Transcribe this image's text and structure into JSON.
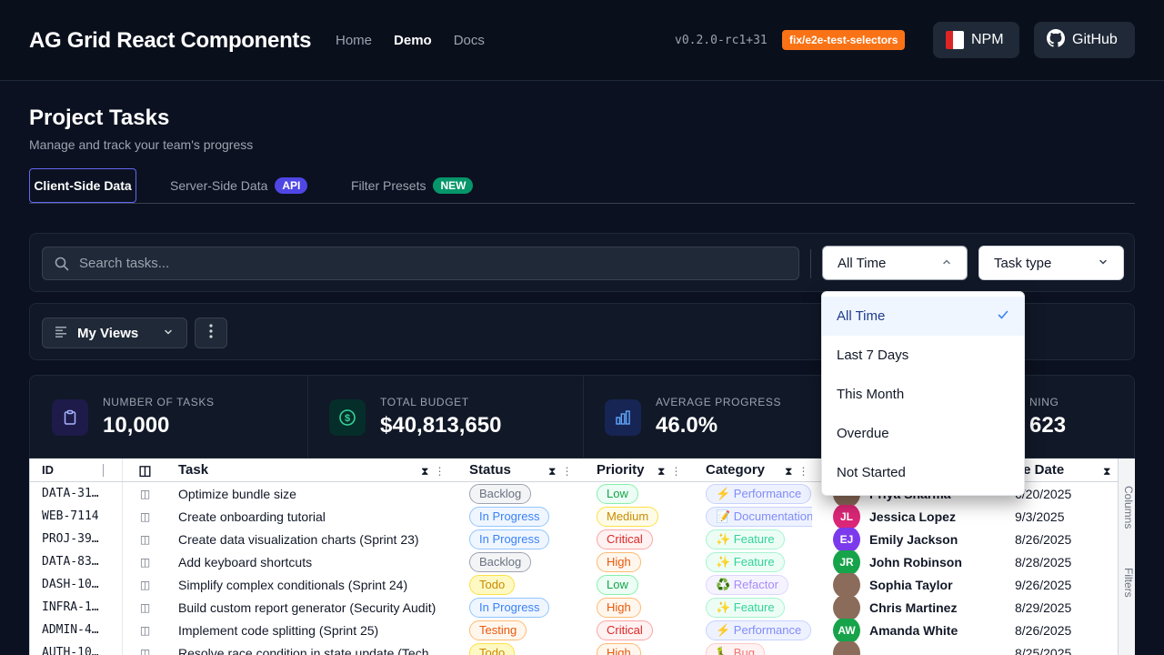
{
  "header": {
    "brand": "AG Grid React Components",
    "nav": [
      "Home",
      "Demo",
      "Docs"
    ],
    "version": "v0.2.0-rc1+31",
    "branch": "fix/e2e-test-selectors",
    "npm_label": "NPM",
    "github_label": "GitHub"
  },
  "page": {
    "title": "Project Tasks",
    "subtitle": "Manage and track your team's progress"
  },
  "tabs": [
    {
      "label": "Client-Side Data",
      "badge": ""
    },
    {
      "label": "Server-Side Data",
      "badge": "API"
    },
    {
      "label": "Filter Presets",
      "badge": "NEW"
    }
  ],
  "filters": {
    "search_placeholder": "Search tasks...",
    "time_value": "All Time",
    "type_value": "Task type"
  },
  "views": {
    "label": "My Views"
  },
  "stats": [
    {
      "label": "NUMBER OF TASKS",
      "value": "10,000"
    },
    {
      "label": "TOTAL BUDGET",
      "value": "$40,813,650"
    },
    {
      "label": "AVERAGE PROGRESS",
      "value": "46.0%"
    },
    {
      "label": "NING",
      "value": "623"
    }
  ],
  "grid": {
    "headers": {
      "id": "ID",
      "task": "Task",
      "status": "Status",
      "priority": "Priority",
      "category": "Category",
      "due": "ue Date"
    },
    "rows": [
      {
        "id": "DATA-31…",
        "task": "Optimize bundle size",
        "status": "Backlog",
        "priority": "Low",
        "category": "⚡ Performance",
        "assignee": "Priya Sharma",
        "initials": "",
        "due": "6/20/2025"
      },
      {
        "id": "WEB-7114",
        "task": "Create onboarding tutorial",
        "status": "In Progress",
        "priority": "Medium",
        "category": "📝 Documentation",
        "assignee": "Jessica Lopez",
        "initials": "JL",
        "due": "9/3/2025"
      },
      {
        "id": "PROJ-39…",
        "task": "Create data visualization charts (Sprint 23)",
        "status": "In Progress",
        "priority": "Critical",
        "category": "✨ Feature",
        "assignee": "Emily Jackson",
        "initials": "EJ",
        "due": "8/26/2025"
      },
      {
        "id": "DATA-83…",
        "task": "Add keyboard shortcuts",
        "status": "Backlog",
        "priority": "High",
        "category": "✨ Feature",
        "assignee": "John Robinson",
        "initials": "JR",
        "due": "8/28/2025"
      },
      {
        "id": "DASH-10…",
        "task": "Simplify complex conditionals (Sprint 24)",
        "status": "Todo",
        "priority": "Low",
        "category": "♻️ Refactor",
        "assignee": "Sophia Taylor",
        "initials": "",
        "due": "9/26/2025"
      },
      {
        "id": "INFRA-1…",
        "task": "Build custom report generator (Security Audit)",
        "status": "In Progress",
        "priority": "High",
        "category": "✨ Feature",
        "assignee": "Chris Martinez",
        "initials": "",
        "due": "8/29/2025"
      },
      {
        "id": "ADMIN-4…",
        "task": "Implement code splitting (Sprint 25)",
        "status": "Testing",
        "priority": "Critical",
        "category": "⚡ Performance",
        "assignee": "Amanda White",
        "initials": "AW",
        "due": "8/26/2025"
      },
      {
        "id": "AUTH-10…",
        "task": "Resolve race condition in state update (Tech",
        "status": "Todo",
        "priority": "High",
        "category": "🐛 Bug",
        "assignee": "",
        "initials": "",
        "due": "8/25/2025"
      }
    ],
    "side_columns": "Columns",
    "side_filters": "Filters"
  },
  "time_menu": {
    "options": [
      "All Time",
      "Last 7 Days",
      "This Month",
      "Overdue",
      "Not Started"
    ],
    "selected": "All Time"
  },
  "colors": {
    "accent": "#6366f1",
    "branch": "#f97316",
    "avatar_jl": "#db2777",
    "avatar_ej": "#7c3aed",
    "avatar_jr": "#16a34a",
    "avatar_aw": "#16a34a"
  }
}
